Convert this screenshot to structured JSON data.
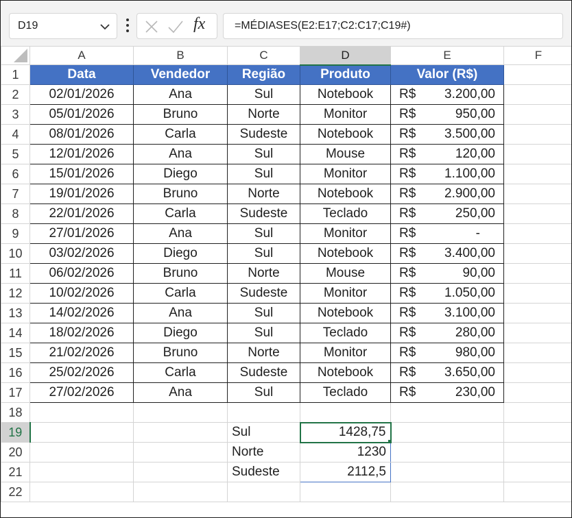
{
  "formula_bar": {
    "name_box": "D19",
    "formula": "=MÉDIASES(E2:E17;C2:C17;C19#)"
  },
  "icons": {
    "name_box_dropdown": "chevron-down-icon",
    "more_options": "vertical-dots-icon",
    "cancel": "x-icon",
    "enter": "check-icon",
    "insert_function": "fx-icon"
  },
  "sheet": {
    "columns": [
      "A",
      "B",
      "C",
      "D",
      "E",
      "F"
    ],
    "active_column": "D",
    "active_row": "19",
    "rows": [
      "1",
      "2",
      "3",
      "4",
      "5",
      "6",
      "7",
      "8",
      "9",
      "10",
      "11",
      "12",
      "13",
      "14",
      "15",
      "16",
      "17",
      "18",
      "19",
      "20",
      "21",
      "22"
    ],
    "table_headers": [
      "Data",
      "Vendedor",
      "Região",
      "Produto",
      "Valor (R$)"
    ],
    "table_rows": [
      {
        "date": "02/01/2026",
        "seller": "Ana",
        "region": "Sul",
        "product": "Notebook",
        "currency": "R$",
        "value": "3.200,00"
      },
      {
        "date": "05/01/2026",
        "seller": "Bruno",
        "region": "Norte",
        "product": "Monitor",
        "currency": "R$",
        "value": "950,00"
      },
      {
        "date": "08/01/2026",
        "seller": "Carla",
        "region": "Sudeste",
        "product": "Notebook",
        "currency": "R$",
        "value": "3.500,00"
      },
      {
        "date": "12/01/2026",
        "seller": "Ana",
        "region": "Sul",
        "product": "Mouse",
        "currency": "R$",
        "value": "120,00"
      },
      {
        "date": "15/01/2026",
        "seller": "Diego",
        "region": "Sul",
        "product": "Monitor",
        "currency": "R$",
        "value": "1.100,00"
      },
      {
        "date": "19/01/2026",
        "seller": "Bruno",
        "region": "Norte",
        "product": "Notebook",
        "currency": "R$",
        "value": "2.900,00"
      },
      {
        "date": "22/01/2026",
        "seller": "Carla",
        "region": "Sudeste",
        "product": "Teclado",
        "currency": "R$",
        "value": "250,00"
      },
      {
        "date": "27/01/2026",
        "seller": "Ana",
        "region": "Sul",
        "product": "Monitor",
        "currency": "R$",
        "value": "-"
      },
      {
        "date": "03/02/2026",
        "seller": "Diego",
        "region": "Sul",
        "product": "Notebook",
        "currency": "R$",
        "value": "3.400,00"
      },
      {
        "date": "06/02/2026",
        "seller": "Bruno",
        "region": "Norte",
        "product": "Mouse",
        "currency": "R$",
        "value": "90,00"
      },
      {
        "date": "10/02/2026",
        "seller": "Carla",
        "region": "Sudeste",
        "product": "Monitor",
        "currency": "R$",
        "value": "1.050,00"
      },
      {
        "date": "14/02/2026",
        "seller": "Ana",
        "region": "Sul",
        "product": "Notebook",
        "currency": "R$",
        "value": "3.100,00"
      },
      {
        "date": "18/02/2026",
        "seller": "Diego",
        "region": "Sul",
        "product": "Teclado",
        "currency": "R$",
        "value": "280,00"
      },
      {
        "date": "21/02/2026",
        "seller": "Bruno",
        "region": "Norte",
        "product": "Monitor",
        "currency": "R$",
        "value": "980,00"
      },
      {
        "date": "25/02/2026",
        "seller": "Carla",
        "region": "Sudeste",
        "product": "Notebook",
        "currency": "R$",
        "value": "3.650,00"
      },
      {
        "date": "27/02/2026",
        "seller": "Ana",
        "region": "Sul",
        "product": "Teclado",
        "currency": "R$",
        "value": "230,00"
      }
    ],
    "summary": [
      {
        "label": "Sul",
        "value": "1428,75"
      },
      {
        "label": "Norte",
        "value": "1230"
      },
      {
        "label": "Sudeste",
        "value": "2112,5"
      }
    ]
  },
  "colors": {
    "header_fill": "#4472c4",
    "selection": "#217346",
    "spill_border": "#4472c4"
  }
}
